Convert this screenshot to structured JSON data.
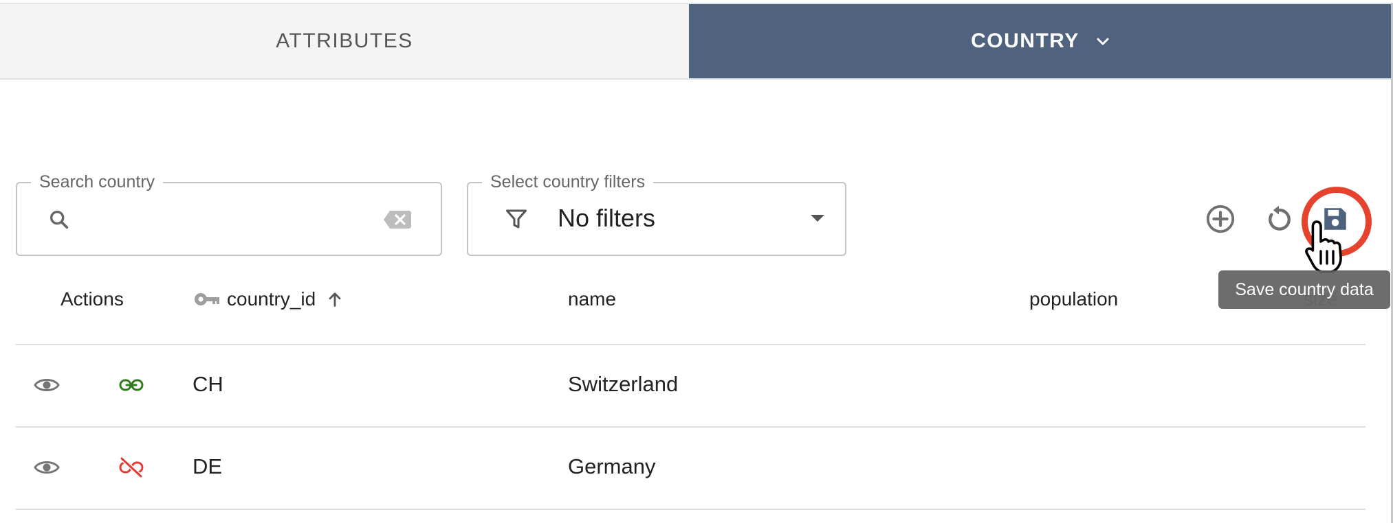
{
  "tabs": {
    "attributes": "ATTRIBUTES",
    "country": "COUNTRY"
  },
  "search": {
    "label": "Search country",
    "value": ""
  },
  "filters": {
    "label": "Select country filters",
    "value": "No filters"
  },
  "toolbar": {
    "tooltip": "Save country data"
  },
  "table": {
    "headers": {
      "actions": "Actions",
      "country_id": "country_id",
      "name": "name",
      "population": "population",
      "size": "size"
    },
    "rows": [
      {
        "country_id": "CH",
        "name": "Switzerland",
        "link_status": "linked"
      },
      {
        "country_id": "DE",
        "name": "Germany",
        "link_status": "unlinked"
      }
    ]
  },
  "colors": {
    "active_tab": "#4f637e",
    "linked": "#2e7d1e",
    "unlinked": "#e53935",
    "highlight": "#e5432e"
  },
  "icons": [
    "search-icon",
    "clear-icon",
    "filter-icon",
    "dropdown-icon",
    "add-icon",
    "reset-icon",
    "save-icon",
    "key-icon",
    "sort-ascending-icon",
    "eye-icon",
    "link-icon",
    "link-off-icon",
    "hand-cursor-icon"
  ]
}
